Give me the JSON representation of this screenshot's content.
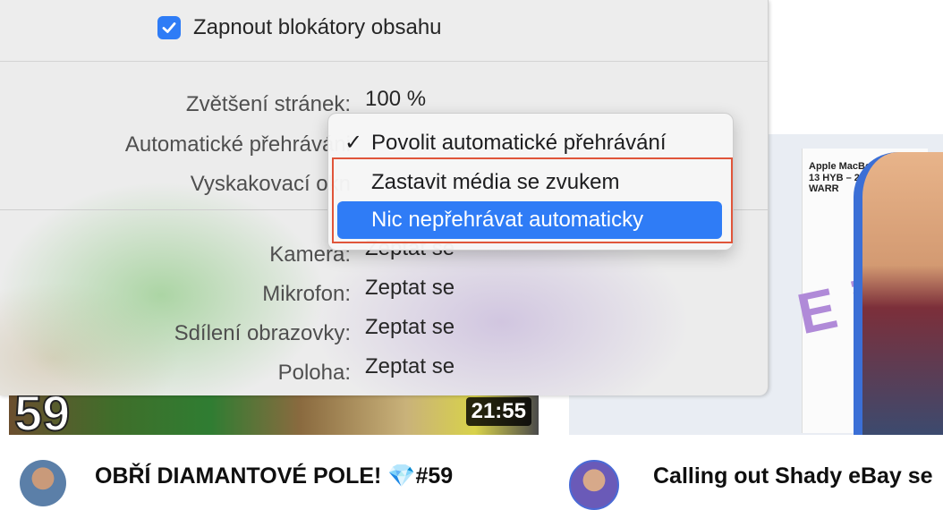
{
  "panel": {
    "content_blockers": {
      "label": "Zapnout blokátory obsahu",
      "checked": true
    },
    "settings": [
      {
        "label": "Zvětšení stránek:",
        "value": "100 %"
      },
      {
        "label": "Automatické přehráváni",
        "value": ""
      },
      {
        "label": "Vyskakovací okn",
        "value": ""
      },
      {
        "label": "Kamera:",
        "value": "Zeptat se"
      },
      {
        "label": "Mikrofon:",
        "value": "Zeptat se"
      },
      {
        "label": "Sdílení obrazovky:",
        "value": "Zeptat se"
      },
      {
        "label": "Poloha:",
        "value": "Zeptat se"
      }
    ]
  },
  "autoplay_menu": {
    "checkmark": "✓",
    "items": [
      {
        "label": "Povolit automatické přehrávání",
        "checked": true,
        "highlighted": false
      },
      {
        "label": "Zastavit média se zvukem",
        "checked": false,
        "highlighted": false
      },
      {
        "label": "Nic nepřehrávat automaticky",
        "checked": false,
        "highlighted": true
      }
    ]
  },
  "background": {
    "left_video": {
      "thumbnail_number": "59",
      "duration": "21:55",
      "title": "OBŘÍ DIAMANTOVÉ POLE! 💎#59"
    },
    "right_video": {
      "title": "Calling out Shady eBay se",
      "thumbnail_heading": "Apple MacBook Pro 13 HYB – 2 YEAR WARR",
      "thumbnail_overlay": "E i2\""
    }
  },
  "colors": {
    "accent_blue": "#2f7cf6",
    "annotation_red": "#e0553a"
  }
}
